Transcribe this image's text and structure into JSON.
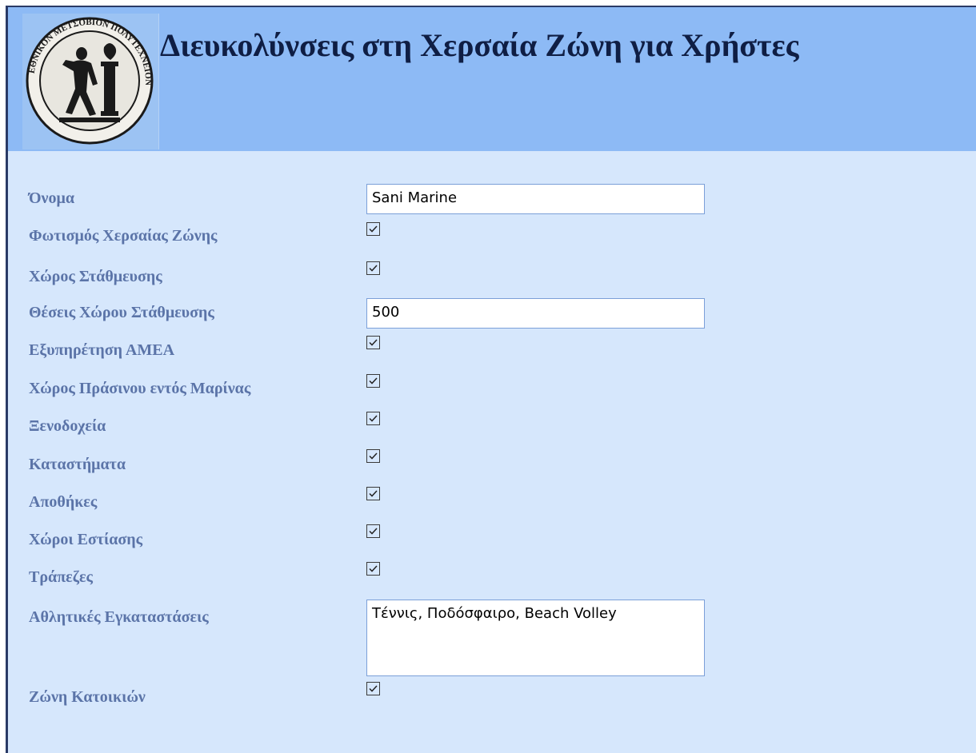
{
  "header": {
    "title": "Διευκολύνσεις στη Χερσαία Ζώνη για Χρήστες",
    "logo_icon": "ntua-seal-logo",
    "logo_text": "ΕΘΝΙΚΟΝ ΜΕΤΣΟΒΙΟΝ ΠΟΛΥΤΕΧΝΕΙΟΝ"
  },
  "colors": {
    "header_bg": "#8dbaf5",
    "form_bg": "#d6e7fc",
    "label": "#5b74a8",
    "title": "#0f1e44"
  },
  "form": {
    "name_label": "Όνομα",
    "name_value": "Sani Marine",
    "lighting_label": "Φωτισμός Χερσαίας Ζώνης",
    "lighting_checked": true,
    "parking_label": "Χώρος Στάθμευσης",
    "parking_checked": true,
    "parking_spots_label": "Θέσεις Χώρου Στάθμευσης",
    "parking_spots_value": "500",
    "accessibility_label": "Εξυπηρέτηση ΑΜΕΑ",
    "accessibility_checked": true,
    "green_space_label": "Χώρος Πράσινου εντός Μαρίνας",
    "green_space_checked": true,
    "hotels_label": "Ξενοδοχεία",
    "hotels_checked": true,
    "shops_label": "Καταστήματα",
    "shops_checked": true,
    "warehouses_label": "Αποθήκες",
    "warehouses_checked": true,
    "dining_label": "Χώροι Εστίασης",
    "dining_checked": true,
    "banks_label": "Τράπεζες",
    "banks_checked": true,
    "sports_label": "Αθλητικές Εγκαταστάσεις",
    "sports_value": "Τέννις, Ποδόσφαιρο, Beach Volley",
    "residential_label": "Ζώνη Κατοικιών",
    "residential_checked": true
  }
}
